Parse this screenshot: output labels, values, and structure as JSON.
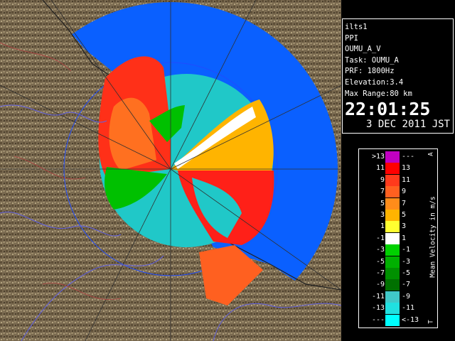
{
  "info": {
    "radar": "ilts1",
    "scan": "PPI",
    "product": "OUMU_A_V",
    "task": "Task: OUMU_A",
    "prf": "PRF: 1800Hz",
    "elevation": "Elevation:3.4",
    "max_range": "Max Range:80 km",
    "time": "22:01:25",
    "date": "3 DEC 2011 JST"
  },
  "legend": {
    "title": "Mean Velocity in m/s",
    "corner_top": "A",
    "corner_bottom": "T",
    "rows": [
      {
        "lo": ">13",
        "hi": "---",
        "color": "#c000c0"
      },
      {
        "lo": "11",
        "hi": "13",
        "color": "#ff0000"
      },
      {
        "lo": "9",
        "hi": "11",
        "color": "#ff3a1c"
      },
      {
        "lo": "7",
        "hi": "9",
        "color": "#ff6020"
      },
      {
        "lo": "5",
        "hi": "7",
        "color": "#ff8c1a"
      },
      {
        "lo": "3",
        "hi": "5",
        "color": "#ffb400"
      },
      {
        "lo": "1",
        "hi": "3",
        "color": "#ffff30"
      },
      {
        "lo": "-1",
        "hi": "1",
        "color": "#ffffff"
      },
      {
        "lo": "-3",
        "hi": "-1",
        "color": "#00d000"
      },
      {
        "lo": "-5",
        "hi": "-3",
        "color": "#00b000"
      },
      {
        "lo": "-7",
        "hi": "-5",
        "color": "#009000"
      },
      {
        "lo": "-9",
        "hi": "-7",
        "color": "#007000"
      },
      {
        "lo": "-11",
        "hi": "-9",
        "color": "#40c8c8"
      },
      {
        "lo": "-13",
        "hi": "-11",
        "color": "#20e0e0"
      },
      {
        "lo": "---",
        "hi": "<-13",
        "color": "#00ffff"
      }
    ]
  },
  "colors": {
    "range_outer": "#1a6aff",
    "range_inner": "#2040ff",
    "terrain": "#7a6a50"
  }
}
